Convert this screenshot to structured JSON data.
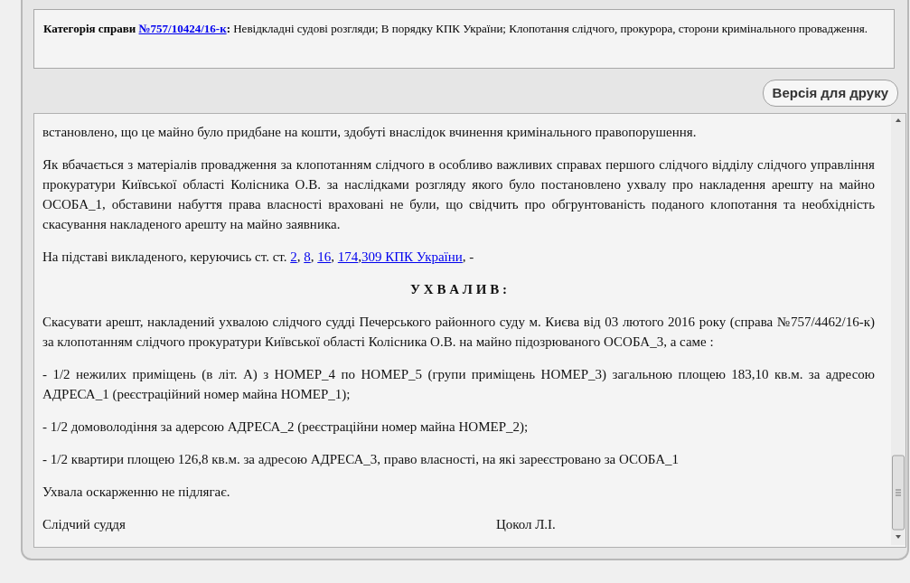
{
  "category": {
    "label": "Категорія справи",
    "case_link": "№757/10424/16-к",
    "colon": ":",
    "text": "Невідкладні судові розгляди; В порядку КПК України; Клопотання слідчого, прокурора, сторони кримінального провадження."
  },
  "print_button": "Версія для друку",
  "document": [
    {
      "kind": "text",
      "text": "встановлено, що це майно було придбане на кошти, здобуті внаслідок вчинення кримінального правопорушення."
    },
    {
      "kind": "text",
      "text": "Як вбачається з матеріалів провадження за клопотанням слідчого в особливо важливих справах першого слідчого відділу слідчого управління прокуратури Київської області Колісника О.В. за наслідками розгляду якого було постановлено ухвалу про накладення арешту на майно ОСОБА_1, обставини набуття права власності враховані не були, що свідчить про обгрунтованість поданого клопотання та необхідність скасування накладеного арешту на майно заявника."
    },
    {
      "kind": "links",
      "segments": [
        {
          "kind": "text",
          "text": "На підставі викладеного, керуючись ст. ст. "
        },
        {
          "kind": "link",
          "text": "2"
        },
        {
          "kind": "text",
          "text": ", "
        },
        {
          "kind": "link",
          "text": "8"
        },
        {
          "kind": "text",
          "text": ", "
        },
        {
          "kind": "link",
          "text": "16"
        },
        {
          "kind": "text",
          "text": ", "
        },
        {
          "kind": "link",
          "text": "174"
        },
        {
          "kind": "text",
          "text": ","
        },
        {
          "kind": "link",
          "text": "309 КПК України"
        },
        {
          "kind": "text",
          "text": ", -"
        }
      ]
    },
    {
      "kind": "heading",
      "text": "У Х В А Л И В :"
    },
    {
      "kind": "text",
      "text": "Скасувати арешт, накладений ухвалою слідчого судді Печерського районного суду м. Києва від 03 лютого 2016 року (справа №757/4462/16-к) за клопотанням слідчого прокуратури Київської області Колісника О.В. на майно підозрюваного ОСОБА_3, а саме :"
    },
    {
      "kind": "text",
      "text": "- 1/2 нежилих приміщень (в літ. А) з НОМЕР_4 по НОМЕР_5 (групи приміщень НОМЕР_3) загальною площею 183,10 кв.м. за адресою АДРЕСА_1 (реєстраційний номер майна НОМЕР_1);"
    },
    {
      "kind": "text",
      "text": "- 1/2 домоволодіння за адерсою АДРЕСА_2 (реєстраційни номер майна НОМЕР_2);"
    },
    {
      "kind": "text",
      "text": "- 1/2 квартири площею 126,8 кв.м. за адресою АДРЕСА_3, право власності, на які зареєстровано за ОСОБА_1"
    },
    {
      "kind": "text",
      "text": "Ухвала оскарженню не підлягає."
    },
    {
      "kind": "signature",
      "role": "Слідчий суддя",
      "name": "Цокол Л.І."
    }
  ]
}
